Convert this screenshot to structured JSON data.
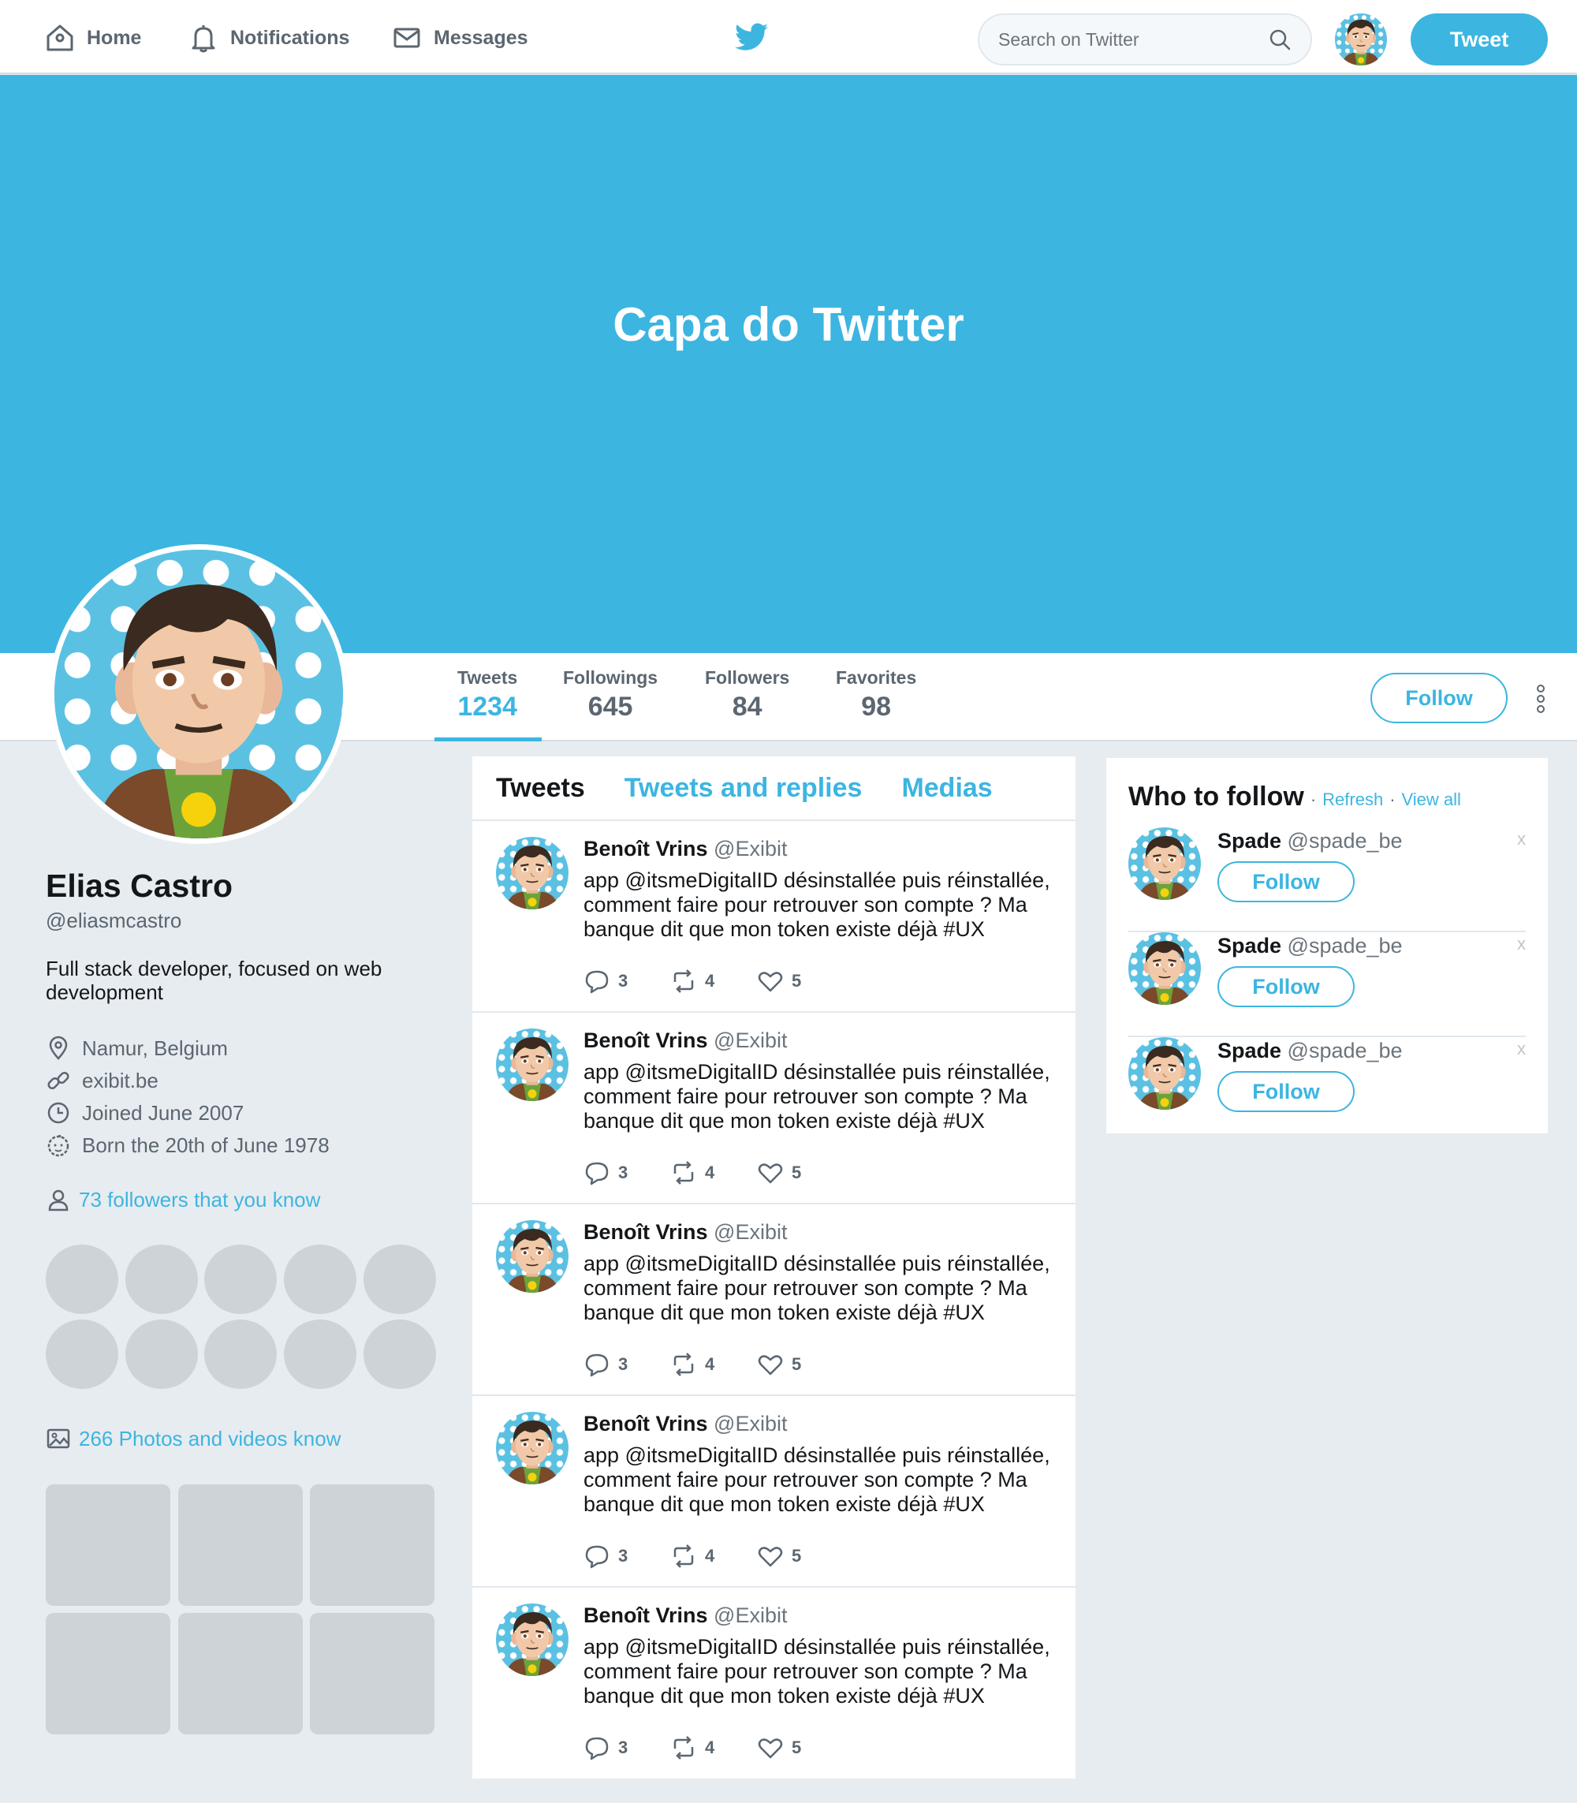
{
  "nav": {
    "home": "Home",
    "notifications": "Notifications",
    "messages": "Messages"
  },
  "search": {
    "placeholder": "Search on Twitter"
  },
  "header": {
    "tweet_label": "Tweet"
  },
  "cover": {
    "title": "Capa do Twitter"
  },
  "stats": [
    {
      "label": "Tweets",
      "value": "1234"
    },
    {
      "label": "Followings",
      "value": "645"
    },
    {
      "label": "Followers",
      "value": "84"
    },
    {
      "label": "Favorites",
      "value": "98"
    }
  ],
  "profile": {
    "follow_label": "Follow",
    "name": "Elias Castro",
    "handle": "@eliasmcastro",
    "bio": "Full stack developer, focused on web development",
    "location": "Namur, Belgium",
    "website": "exibit.be",
    "joined": "Joined June 2007",
    "born": "Born the 20th of June 1978",
    "followers_known": "73 followers that you know",
    "photos": "266 Photos and videos know"
  },
  "tabs": [
    {
      "label": "Tweets"
    },
    {
      "label": "Tweets and replies"
    },
    {
      "label": "Medias"
    }
  ],
  "tweets": [
    {
      "name": "Benoît Vrins",
      "handle": "@Exibit",
      "text": "app @itsmeDigitalID désinstallée puis réinstallée, comment faire pour retrouver son compte ? Ma banque dit que mon token existe déjà #UX",
      "replies": "3",
      "retweets": "4",
      "likes": "5"
    },
    {
      "name": "Benoît Vrins",
      "handle": "@Exibit",
      "text": "app @itsmeDigitalID désinstallée puis réinstallée, comment faire pour retrouver son compte ? Ma banque dit que mon token existe déjà #UX",
      "replies": "3",
      "retweets": "4",
      "likes": "5"
    },
    {
      "name": "Benoît Vrins",
      "handle": "@Exibit",
      "text": "app @itsmeDigitalID désinstallée puis réinstallée, comment faire pour retrouver son compte ? Ma banque dit que mon token existe déjà #UX",
      "replies": "3",
      "retweets": "4",
      "likes": "5"
    },
    {
      "name": "Benoît Vrins",
      "handle": "@Exibit",
      "text": "app @itsmeDigitalID désinstallée puis réinstallée, comment faire pour retrouver son compte ? Ma banque dit que mon token existe déjà #UX",
      "replies": "3",
      "retweets": "4",
      "likes": "5"
    },
    {
      "name": "Benoît Vrins",
      "handle": "@Exibit",
      "text": "app @itsmeDigitalID désinstallée puis réinstallée, comment faire pour retrouver son compte ? Ma banque dit que mon token existe déjà #UX",
      "replies": "3",
      "retweets": "4",
      "likes": "5"
    }
  ],
  "who_to_follow": {
    "title": "Who to follow",
    "separator": "·",
    "refresh": "Refresh",
    "view_all": "View all",
    "items": [
      {
        "name": "Spade",
        "handle": "@spade_be",
        "follow_label": "Follow",
        "dismiss": "x"
      },
      {
        "name": "Spade",
        "handle": "@spade_be",
        "follow_label": "Follow",
        "dismiss": "x"
      },
      {
        "name": "Spade",
        "handle": "@spade_be",
        "follow_label": "Follow",
        "dismiss": "x"
      }
    ]
  },
  "colors": {
    "accent": "#3cb5e1",
    "background": "#e7ecf0",
    "placeholder": "#ced3d7",
    "text": "#14171a",
    "muted": "#5b6670"
  },
  "icons": [
    "home-icon",
    "bell-icon",
    "mail-icon",
    "twitter-bird-icon",
    "search-icon",
    "more-vertical-icon",
    "location-pin-icon",
    "link-icon",
    "clock-icon",
    "baby-icon",
    "person-icon",
    "image-icon",
    "reply-icon",
    "retweet-icon",
    "heart-icon"
  ]
}
